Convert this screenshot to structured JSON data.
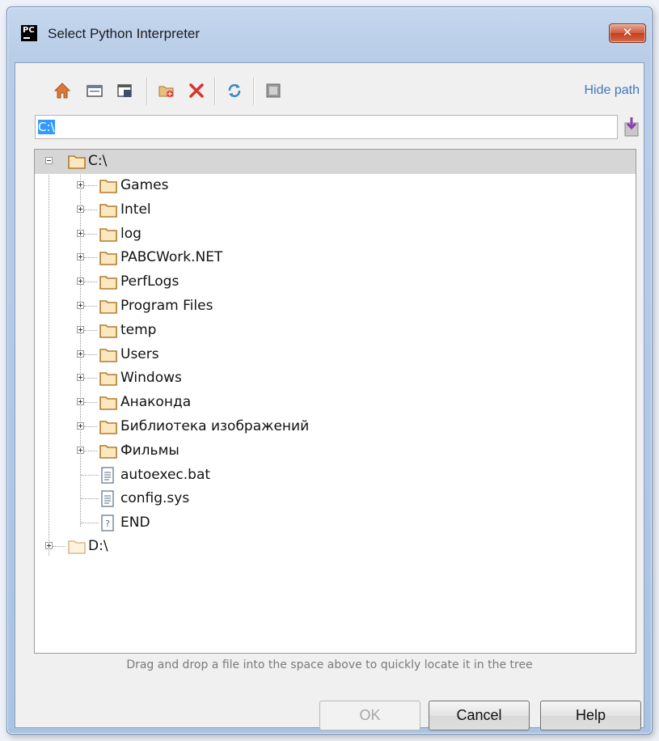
{
  "window": {
    "title": "Select Python Interpreter",
    "app_icon_text": "PC",
    "close_glyph": "✕"
  },
  "toolbar": {
    "icons": [
      "home-icon",
      "desktop-icon",
      "project-icon",
      "new-folder-icon",
      "delete-icon",
      "refresh-icon",
      "show-hidden-icon"
    ],
    "hide_path_label": "Hide path"
  },
  "path": {
    "value": "C:\\"
  },
  "tree": {
    "root_c": "C:\\",
    "items": [
      {
        "label": "Games",
        "type": "folder"
      },
      {
        "label": "Intel",
        "type": "folder"
      },
      {
        "label": "log",
        "type": "folder"
      },
      {
        "label": "PABCWork.NET",
        "type": "folder"
      },
      {
        "label": "PerfLogs",
        "type": "folder"
      },
      {
        "label": "Program Files",
        "type": "folder"
      },
      {
        "label": "temp",
        "type": "folder"
      },
      {
        "label": "Users",
        "type": "folder"
      },
      {
        "label": "Windows",
        "type": "folder"
      },
      {
        "label": "Анаконда",
        "type": "folder"
      },
      {
        "label": "Библиотека изображений",
        "type": "folder"
      },
      {
        "label": "Фильмы",
        "type": "folder"
      },
      {
        "label": "autoexec.bat",
        "type": "file"
      },
      {
        "label": "config.sys",
        "type": "file"
      },
      {
        "label": "END",
        "type": "unknown"
      }
    ],
    "root_d": "D:\\"
  },
  "hint": "Drag and drop a file into the space above to quickly locate it in the tree",
  "buttons": {
    "ok": "OK",
    "cancel": "Cancel",
    "help": "Help"
  },
  "colors": {
    "folder": "#c9923a",
    "selection": "#3399ff",
    "link": "#3c78c0"
  }
}
